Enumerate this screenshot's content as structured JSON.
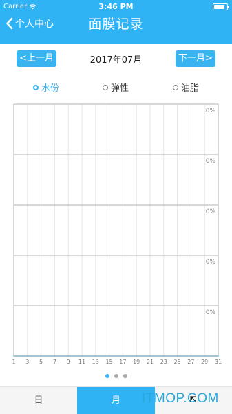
{
  "status_bar": {
    "carrier": "Carrier",
    "time": "3:46 PM",
    "battery": 0.85
  },
  "nav": {
    "back_label": "个人中心",
    "title": "面膜记录"
  },
  "month_nav": {
    "prev_label": "<上一月",
    "current": "2017年07月",
    "next_label": "下一月>"
  },
  "tabs": [
    {
      "label": "水份",
      "active": true
    },
    {
      "label": "弹性",
      "active": false
    },
    {
      "label": "油脂",
      "active": false
    }
  ],
  "chart_data": {
    "type": "line",
    "x_ticks": [
      "1",
      "3",
      "5",
      "7",
      "9",
      "11",
      "13",
      "15",
      "17",
      "19",
      "21",
      "23",
      "25",
      "27",
      "29",
      "31"
    ],
    "y_band_labels": [
      "0%",
      "0%",
      "0%",
      "0%",
      "0%"
    ],
    "x": [
      1,
      3,
      5,
      7,
      9,
      11,
      13,
      15,
      17,
      19,
      21,
      23,
      25,
      27,
      29,
      31
    ],
    "series": [
      {
        "values": [
          0,
          0,
          0,
          0,
          0,
          0,
          0,
          0,
          0,
          0,
          0,
          0,
          0,
          0,
          0,
          0
        ]
      }
    ],
    "grid": true,
    "colors": {
      "line": "#3ab4f0",
      "grid_major": "#b0b0b0",
      "grid_minor": "#e6e6e6"
    }
  },
  "pager": {
    "count": 3,
    "active_index": 0
  },
  "bottom_tabs": {
    "day_label": "日",
    "month_label": "月"
  },
  "watermark": {
    "text": "ITMOP.COM"
  },
  "colors": {
    "accent": "#2fb3f4"
  }
}
